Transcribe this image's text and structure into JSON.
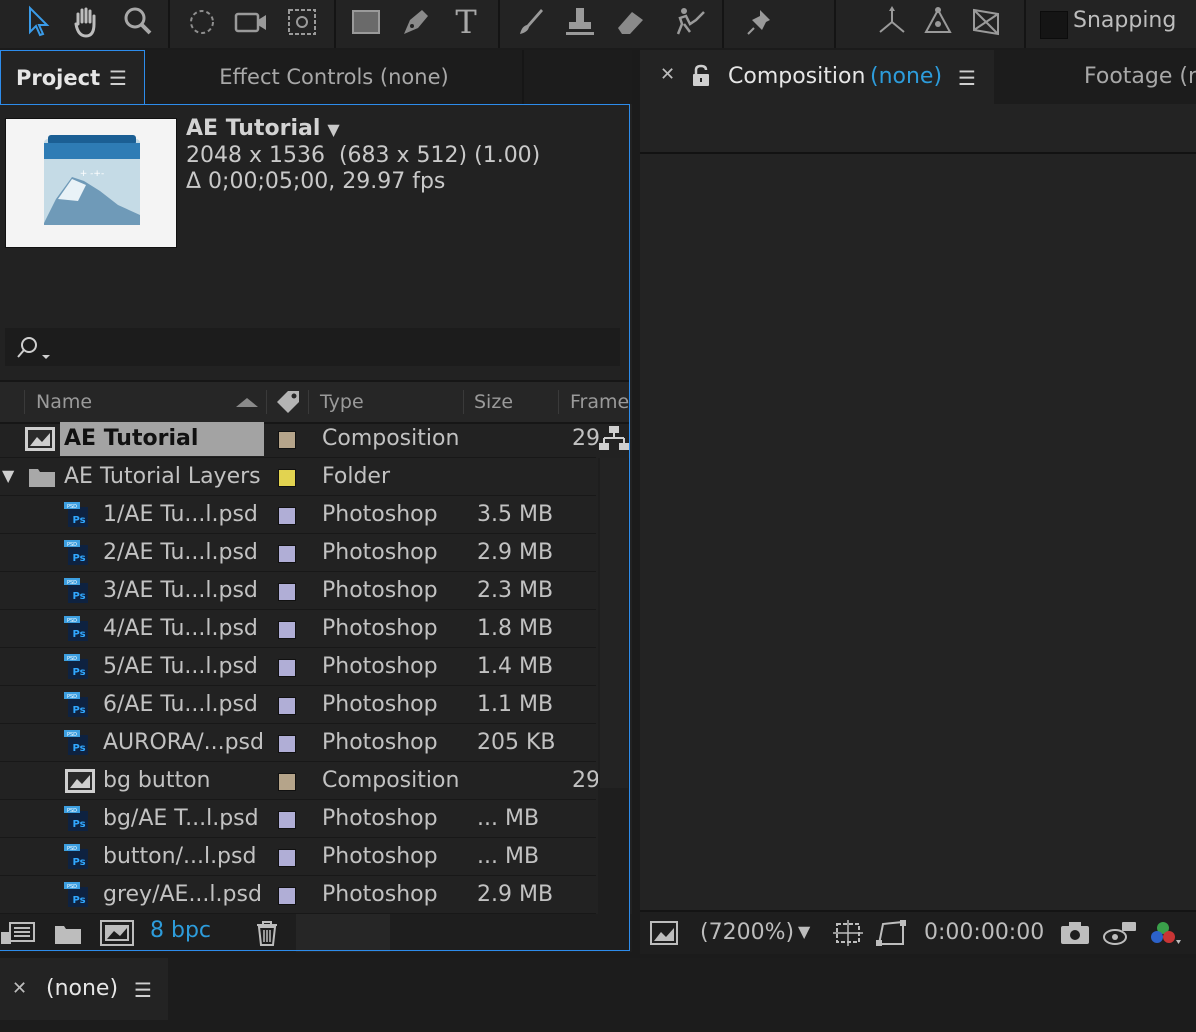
{
  "toolbar": {
    "tools": [
      "selection-tool",
      "hand-tool",
      "zoom-tool",
      "rotate-tool",
      "camera-tool",
      "pan-behind-tool",
      "rectangle-tool",
      "pen-tool",
      "type-tool",
      "brush-tool",
      "clone-stamp-tool",
      "eraser-tool",
      "roto-brush-tool",
      "puppet-pin-tool",
      "world-axis-mode",
      "local-axis-mode",
      "view-axis-mode"
    ],
    "snapping_label": "Snapping"
  },
  "project_panel": {
    "tab_label": "Project",
    "effect_controls_label": "Effect Controls (none)",
    "preview": {
      "name": "AE Tutorial",
      "dimensions": "2048 x 1536  (683 x 512) (1.00)",
      "duration": "Δ 0;00;05;00, 29.97 fps"
    },
    "search_placeholder": "",
    "columns": {
      "name": "Name",
      "type": "Type",
      "size": "Size",
      "frame": "Frame"
    },
    "items": [
      {
        "name": "AE Tutorial",
        "type": "Composition",
        "size": "",
        "frame": "29",
        "kind": "comp",
        "label_color": "#b5a48a",
        "indent": 0,
        "selected": true
      },
      {
        "name": "AE Tutorial Layers",
        "type": "Folder",
        "size": "",
        "frame": "",
        "kind": "folder",
        "label_color": "#e2d350",
        "indent": 0
      },
      {
        "name": "1/AE Tu...l.psd",
        "type": "Photoshop",
        "size": "3.5 MB",
        "frame": "",
        "kind": "psd",
        "label_color": "#b0aed6",
        "indent": 1
      },
      {
        "name": "2/AE Tu...l.psd",
        "type": "Photoshop",
        "size": "2.9 MB",
        "frame": "",
        "kind": "psd",
        "label_color": "#b0aed6",
        "indent": 1
      },
      {
        "name": "3/AE Tu...l.psd",
        "type": "Photoshop",
        "size": "2.3 MB",
        "frame": "",
        "kind": "psd",
        "label_color": "#b0aed6",
        "indent": 1
      },
      {
        "name": "4/AE Tu...l.psd",
        "type": "Photoshop",
        "size": "1.8 MB",
        "frame": "",
        "kind": "psd",
        "label_color": "#b0aed6",
        "indent": 1
      },
      {
        "name": "5/AE Tu...l.psd",
        "type": "Photoshop",
        "size": "1.4 MB",
        "frame": "",
        "kind": "psd",
        "label_color": "#b0aed6",
        "indent": 1
      },
      {
        "name": "6/AE Tu...l.psd",
        "type": "Photoshop",
        "size": "1.1 MB",
        "frame": "",
        "kind": "psd",
        "label_color": "#b0aed6",
        "indent": 1
      },
      {
        "name": "AURORA/...psd",
        "type": "Photoshop",
        "size": "205 KB",
        "frame": "",
        "kind": "psd",
        "label_color": "#b0aed6",
        "indent": 1
      },
      {
        "name": "bg button",
        "type": "Composition",
        "size": "",
        "frame": "29",
        "kind": "comp",
        "label_color": "#b5a48a",
        "indent": 1
      },
      {
        "name": "bg/AE T...l.psd",
        "type": "Photoshop",
        "size": "... MB",
        "frame": "",
        "kind": "psd",
        "label_color": "#b0aed6",
        "indent": 1
      },
      {
        "name": "button/...l.psd",
        "type": "Photoshop",
        "size": "... MB",
        "frame": "",
        "kind": "psd",
        "label_color": "#b0aed6",
        "indent": 1
      },
      {
        "name": "grey/AE...l.psd",
        "type": "Photoshop",
        "size": "2.9 MB",
        "frame": "",
        "kind": "psd",
        "label_color": "#b0aed6",
        "indent": 1
      }
    ],
    "bpc_label": "8 bpc"
  },
  "composition_panel": {
    "tab_label": "Composition",
    "tab_value": "(none)",
    "footage_label": "Footage (n",
    "zoom": "(7200%)",
    "timecode": "0:00:00:00"
  },
  "timeline": {
    "tab_label": "(none)"
  },
  "colors": {
    "accent": "#2d8ceb",
    "blue_text": "#2d9cdb",
    "panel": "#222222"
  }
}
